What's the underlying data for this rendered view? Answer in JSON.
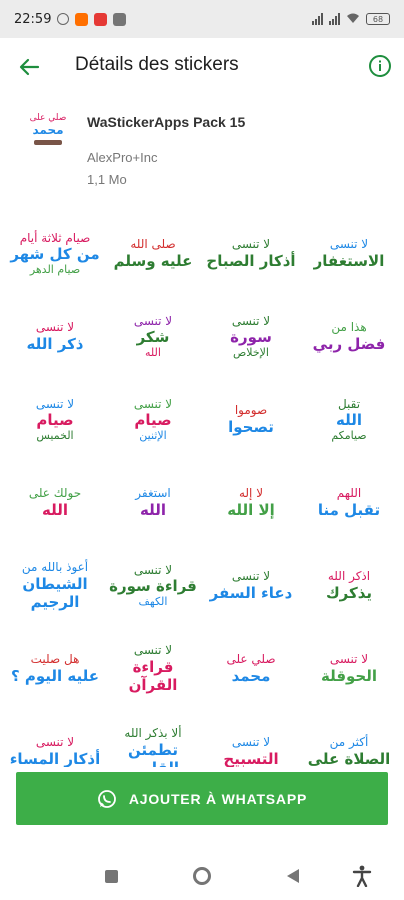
{
  "status_bar": {
    "time": "22:59",
    "battery": "68"
  },
  "app_bar": {
    "title": "Détails des stickers",
    "back_icon": "arrow-left-icon",
    "info_icon": "info-circle-icon"
  },
  "pack": {
    "name": "WaStickerApps Pack 15",
    "author": "AlexPro+Inc",
    "size": "1,1 Mo",
    "icon_lines": [
      "صلي على",
      "محمد"
    ]
  },
  "stickers": [
    {
      "lines": [
        "صيام ثلاثة أيام",
        "من كل شهر",
        "صيام الدهر"
      ],
      "colors": [
        "#d81b60",
        "#1e88e5",
        "#43a047"
      ]
    },
    {
      "lines": [
        "صلى الله",
        "عليه وسلم",
        ""
      ],
      "colors": [
        "#d32f2f",
        "#2e7d32",
        "#2e7d32"
      ]
    },
    {
      "lines": [
        "لا تنسى",
        "أذكار الصباح",
        ""
      ],
      "colors": [
        "#2e7d32",
        "#2e7d32",
        "#2e7d32"
      ]
    },
    {
      "lines": [
        "لا تنسى",
        "الاستغفار",
        ""
      ],
      "colors": [
        "#1e88e5",
        "#2e7d32",
        "#2e7d32"
      ]
    },
    {
      "lines": [
        "لا تنسى",
        "ذكر الله",
        ""
      ],
      "colors": [
        "#d81b60",
        "#1e88e5",
        "#1e88e5"
      ]
    },
    {
      "lines": [
        "لا تنسى",
        "شكر",
        "الله"
      ],
      "colors": [
        "#8e24aa",
        "#2e7d32",
        "#d81b60"
      ]
    },
    {
      "lines": [
        "لا تنسى",
        "سورة",
        "الإخلاص"
      ],
      "colors": [
        "#2e7d32",
        "#8e24aa",
        "#2e7d32"
      ]
    },
    {
      "lines": [
        "هذا من",
        "فضل ربي",
        ""
      ],
      "colors": [
        "#43a047",
        "#8e24aa",
        "#8e24aa"
      ]
    },
    {
      "lines": [
        "لا تنسى",
        "صيام",
        "الخميس"
      ],
      "colors": [
        "#1e88e5",
        "#d81b60",
        "#2e7d32"
      ]
    },
    {
      "lines": [
        "لا تنسى",
        "صيام",
        "الإثنين"
      ],
      "colors": [
        "#43a047",
        "#d81b60",
        "#1e88e5"
      ]
    },
    {
      "lines": [
        "صوموا",
        "تصحوا",
        ""
      ],
      "colors": [
        "#d32f2f",
        "#1e88e5",
        "#1e88e5"
      ]
    },
    {
      "lines": [
        "تقبل",
        "الله",
        "صيامكم"
      ],
      "colors": [
        "#2e7d32",
        "#1e88e5",
        "#2e7d32"
      ]
    },
    {
      "lines": [
        "حولك على",
        "الله",
        ""
      ],
      "colors": [
        "#43a047",
        "#d81b60",
        "#d81b60"
      ]
    },
    {
      "lines": [
        "استغفر",
        "الله",
        ""
      ],
      "colors": [
        "#1e88e5",
        "#8e24aa",
        "#8e24aa"
      ]
    },
    {
      "lines": [
        "لا إله",
        "إلا الله",
        ""
      ],
      "colors": [
        "#d32f2f",
        "#43a047",
        "#43a047"
      ]
    },
    {
      "lines": [
        "اللهم",
        "تقبل منا",
        ""
      ],
      "colors": [
        "#d81b60",
        "#1e88e5",
        "#1e88e5"
      ]
    },
    {
      "lines": [
        "أعوذ بالله من",
        "الشيطان الرجيم",
        ""
      ],
      "colors": [
        "#1e88e5",
        "#1e88e5",
        "#1e88e5"
      ]
    },
    {
      "lines": [
        "لا تنسى",
        "قراءة سورة",
        "الكهف"
      ],
      "colors": [
        "#2e7d32",
        "#2e7d32",
        "#1e88e5"
      ]
    },
    {
      "lines": [
        "لا تنسى",
        "دعاء السفر",
        ""
      ],
      "colors": [
        "#2e7d32",
        "#1e88e5",
        "#1e88e5"
      ]
    },
    {
      "lines": [
        "اذكر الله",
        "يذكرك",
        ""
      ],
      "colors": [
        "#d81b60",
        "#2e7d32",
        "#2e7d32"
      ]
    },
    {
      "lines": [
        "هل صليت",
        "عليه اليوم ؟",
        ""
      ],
      "colors": [
        "#d32f2f",
        "#1e88e5",
        "#1e88e5"
      ]
    },
    {
      "lines": [
        "لا تنسى",
        "قراءة القرآن",
        ""
      ],
      "colors": [
        "#2e7d32",
        "#d81b60",
        "#d81b60"
      ]
    },
    {
      "lines": [
        "صلي على",
        "محمد",
        ""
      ],
      "colors": [
        "#d81b60",
        "#1e88e5",
        "#1e88e5"
      ]
    },
    {
      "lines": [
        "لا تنسى",
        "الحوقلة",
        ""
      ],
      "colors": [
        "#d81b60",
        "#43a047",
        "#43a047"
      ]
    },
    {
      "lines": [
        "لا تنسى",
        "أذكار المساء",
        ""
      ],
      "colors": [
        "#d81b60",
        "#1e88e5",
        "#1e88e5"
      ]
    },
    {
      "lines": [
        "ألا بذكر الله",
        "تطمئن القلوب",
        ""
      ],
      "colors": [
        "#2e7d32",
        "#1e88e5",
        "#1e88e5"
      ]
    },
    {
      "lines": [
        "لا تنسى",
        "التسبيح",
        ""
      ],
      "colors": [
        "#1e88e5",
        "#d81b60",
        "#d81b60"
      ]
    },
    {
      "lines": [
        "أكثر من",
        "الصلاة على",
        ""
      ],
      "colors": [
        "#1e88e5",
        "#2e7d32",
        "#2e7d32"
      ]
    }
  ],
  "add_button": {
    "label": "AJOUTER À WHATSAPP",
    "icon": "whatsapp-icon",
    "color": "#3dae48"
  },
  "nav_bar": {
    "recents_icon": "square-icon",
    "home_icon": "circle-icon",
    "back_icon": "triangle-back-icon",
    "accessibility_icon": "accessibility-icon"
  },
  "accent": "#1e8e3e"
}
